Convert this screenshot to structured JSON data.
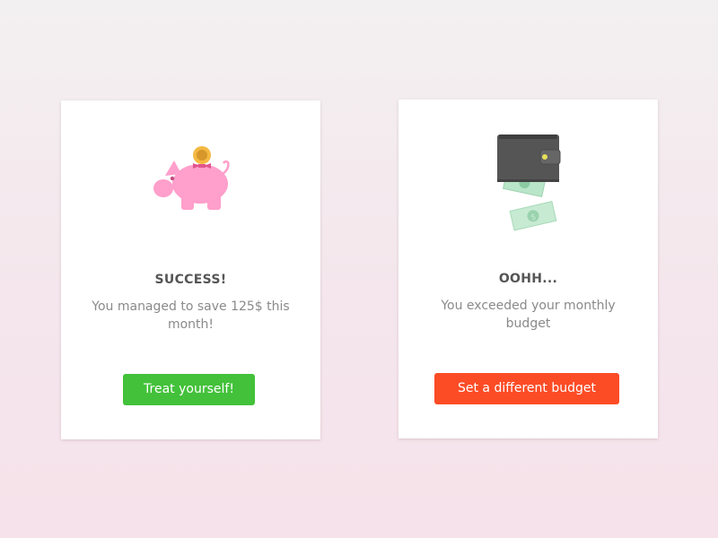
{
  "cards": {
    "success": {
      "title": "SUCCESS!",
      "message": "You managed to save 125$ this month!",
      "button_label": "Treat yourself!",
      "icon": "piggy-bank-icon"
    },
    "warning": {
      "title": "OOHH...",
      "message": "You exceeded your monthly budget",
      "button_label": "Set a different budget",
      "icon": "wallet-money-icon"
    }
  },
  "colors": {
    "success_button": "#43c13a",
    "warning_button": "#fc4c26",
    "piggy": "#ff9fcb",
    "coin": "#f4b942",
    "wallet": "#555555",
    "banknote": "#b9e5c8"
  }
}
